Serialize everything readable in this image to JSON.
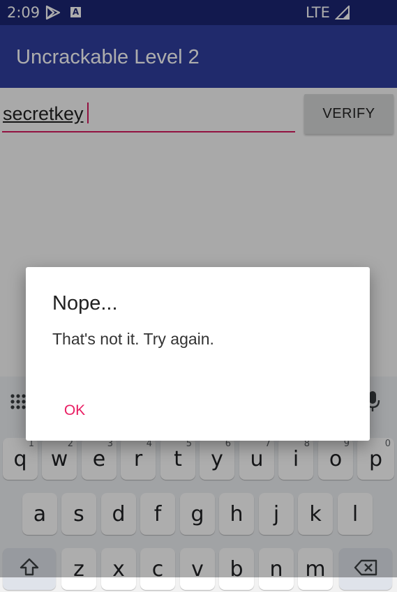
{
  "status_bar": {
    "time": "2:09",
    "network": "LTE",
    "icons": [
      "play-store-icon",
      "a-badge-icon",
      "signal-icon"
    ],
    "badge_letter": "A"
  },
  "app_bar": {
    "title": "Uncrackable Level 2"
  },
  "form": {
    "input_value": "secretkey",
    "verify_label": "VERIFY"
  },
  "dialog": {
    "title": "Nope...",
    "message": "That's not it. Try again.",
    "ok_label": "OK"
  },
  "keyboard": {
    "row1": [
      {
        "key": "q",
        "hint": "1"
      },
      {
        "key": "w",
        "hint": "2"
      },
      {
        "key": "e",
        "hint": "3"
      },
      {
        "key": "r",
        "hint": "4"
      },
      {
        "key": "t",
        "hint": "5"
      },
      {
        "key": "y",
        "hint": "6"
      },
      {
        "key": "u",
        "hint": "7"
      },
      {
        "key": "i",
        "hint": "8"
      },
      {
        "key": "o",
        "hint": "9"
      },
      {
        "key": "p",
        "hint": "0"
      }
    ],
    "row2": [
      "a",
      "s",
      "d",
      "f",
      "g",
      "h",
      "j",
      "k",
      "l"
    ],
    "row3": [
      "z",
      "x",
      "c",
      "v",
      "b",
      "n",
      "m"
    ],
    "icons": [
      "apps-grid-icon",
      "microphone-icon",
      "shift-icon",
      "backspace-icon"
    ]
  },
  "colors": {
    "status_bar": "#1b2573",
    "app_bar": "#303f9f",
    "accent": "#e91e63",
    "underline": "#d81b60"
  }
}
